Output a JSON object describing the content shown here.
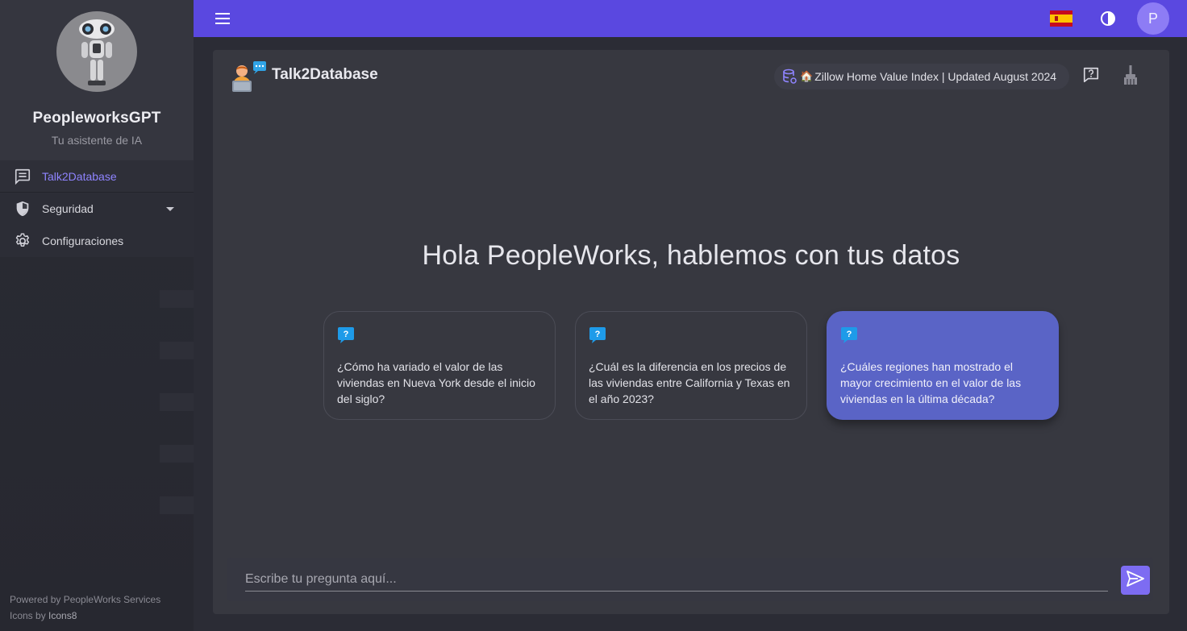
{
  "sidebar": {
    "app_name": "PeopleworksGPT",
    "app_subtitle": "Tu asistente de IA",
    "items": [
      {
        "label": "Talk2Database",
        "icon": "chat-icon",
        "active": true
      },
      {
        "label": "Seguridad",
        "icon": "shield-icon",
        "expandable": true
      },
      {
        "label": "Configuraciones",
        "icon": "gear-icon"
      }
    ],
    "credits": {
      "powered_by": "Powered by PeopleWorks Services",
      "icons_by_prefix": "Icons by ",
      "icons_by_name": "Icons8"
    }
  },
  "topbar": {
    "menu_icon": "hamburger-menu-icon",
    "language_flag": "spain-flag-icon",
    "theme_icon": "contrast-icon",
    "user_initial": "P"
  },
  "main": {
    "title": "Talk2Database",
    "dataset_chip": "Zillow Home Value Index | Updated August 2024",
    "greeting": "Hola PeopleWorks, hablemos con tus datos",
    "suggestions": [
      {
        "text": "¿Cómo ha variado el valor de las viviendas en Nueva York desde el inicio del siglo?"
      },
      {
        "text": "¿Cuál es la diferencia en los precios de las viviendas entre California y Texas en el año 2023?"
      },
      {
        "text": "¿Cuáles regiones han mostrado el mayor crecimiento en el valor de las viviendas en la última década?",
        "highlighted": true
      }
    ],
    "input": {
      "placeholder": "Escribe tu pregunta aquí...",
      "value": ""
    }
  },
  "colors": {
    "accent": "#5a48e0",
    "active_nav": "#8f84ff",
    "highlight_card": "#5a64c6",
    "send_button": "#7d6cf2"
  }
}
